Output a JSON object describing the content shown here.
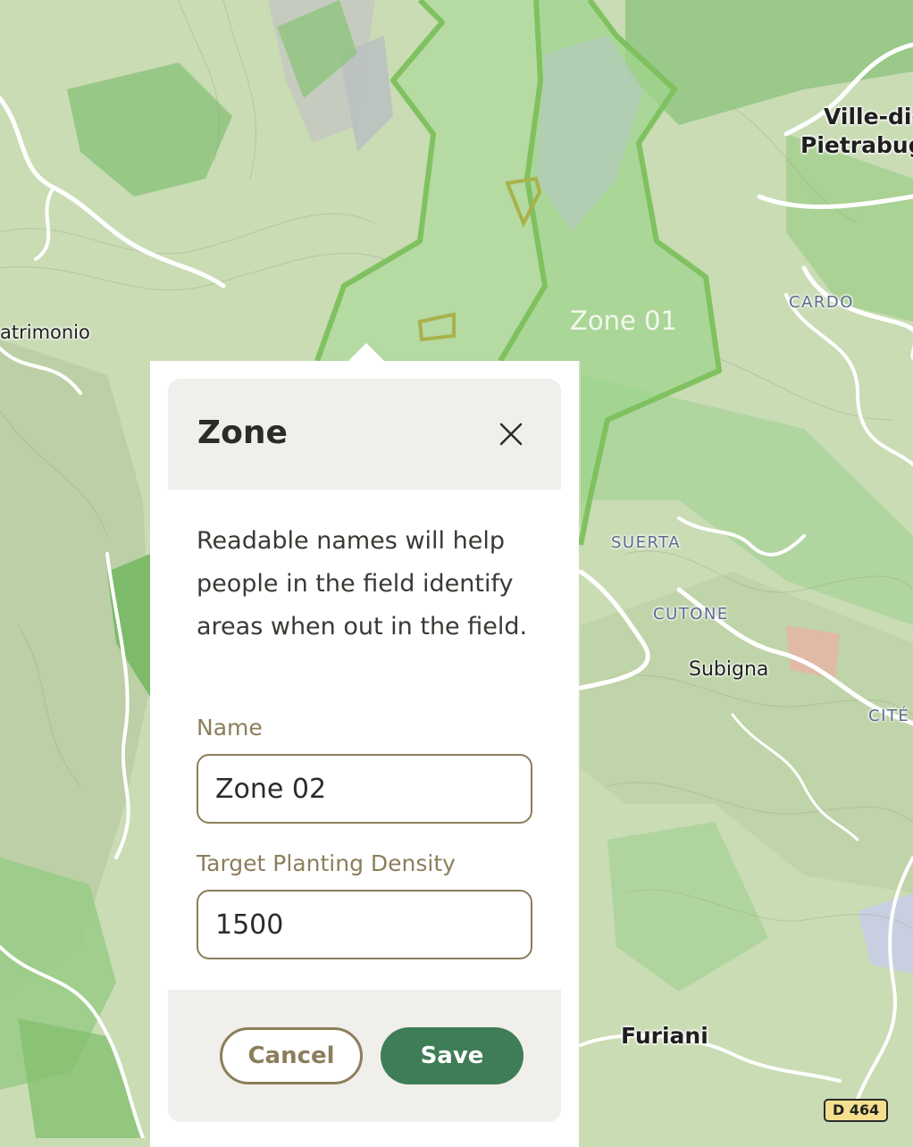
{
  "map": {
    "labels": {
      "ville": "Ville-di-",
      "pietrabugno": "Pietrabugno",
      "cardo": "CARDO",
      "patrimonio": "atrimonio",
      "zone01": "Zone 01",
      "suerta": "SUERTA",
      "cutone": "CUTONE",
      "subigna": "Subigna",
      "cite": "CITÉ",
      "furiani": "Furiani",
      "road": "D 464"
    },
    "colors": {
      "terrain": "#c9dcb4",
      "forest": "#8fc47e",
      "zone_fill": "#9fd48e",
      "zone_border": "#7cc05c",
      "roads": "#ffffff"
    }
  },
  "popup": {
    "title": "Zone",
    "close_icon": "close-icon",
    "help_text": "Readable names will help people in the field identify areas when out in the field.",
    "name_label": "Name",
    "name_value": "Zone 02",
    "density_label": "Target Planting Density",
    "density_value": "1500",
    "cancel_label": "Cancel",
    "save_label": "Save",
    "colors": {
      "accent": "#3f7d56",
      "label": "#8c7e5b",
      "panel": "#f0efeb"
    }
  }
}
